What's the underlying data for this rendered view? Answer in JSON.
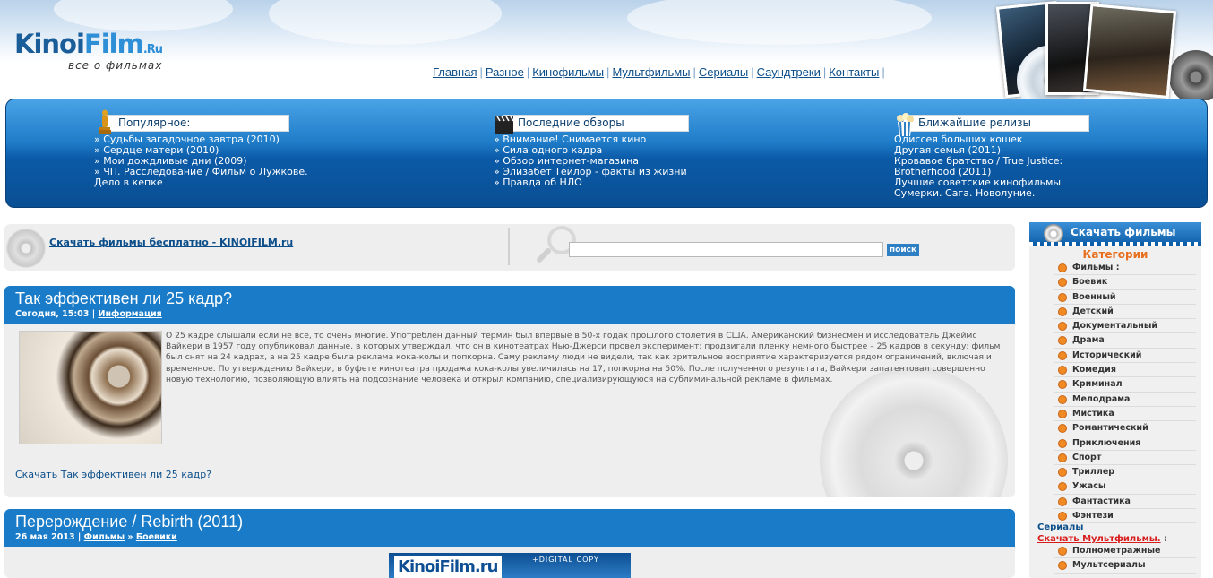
{
  "header": {
    "logo_main": "Kinoi",
    "logo_i": "Film",
    "logo_ru": ".Ru",
    "logo_sub": "все о фильмах",
    "nav": [
      "Главная",
      "Разное",
      "Кинофильмы",
      "Мультфильмы",
      "Сериалы",
      "Саундтреки",
      "Контакты"
    ]
  },
  "band": {
    "popular": {
      "title": "Популярное:",
      "items": [
        "» Судьбы загадочное завтра (2010)",
        "» Сердце матери (2010)",
        "» Мои дождливые дни (2009)",
        "» ЧП. Расследование / Фильм о Лужкове.",
        "Дело в кепке"
      ]
    },
    "reviews": {
      "title": "Последние обзоры",
      "items": [
        "» Внимание! Снимается кино",
        "» Сила одного кадра",
        "» Обзор интернет-магазина",
        "» Элизабет Тейлор - факты из жизни",
        "» Правда об НЛО"
      ]
    },
    "releases": {
      "title": "Ближайшие релизы",
      "items": [
        "Одиссея больших кошек",
        "Другая семья (2011)",
        "Кровавое братство / True Justice:",
        "Brotherhood (2011)",
        "Лучшие советские кинофильмы",
        "Сумерки. Сага. Новолуние."
      ]
    }
  },
  "search": {
    "download_link": "Скачать фильмы бесплатно - KINOIFILM.ru",
    "input_value": "",
    "button": "поиск"
  },
  "articles": [
    {
      "title": "Так эффективен ли 25 кадр?",
      "date": "Сегодня, 15:03",
      "sep": "|",
      "category": "Информация",
      "text": "О 25 кадре слышали если не все, то очень многие. Употреблен данный термин был впервые в 50-х годах прошлого столетия в США. Американский бизнесмен и исследователь Джеймс Вайкери в 1957 году опубликовал данные, в которых утверждал, что он в кинотеатрах Нью-Джерси провел эксперимент: продвигали пленку немного быстрее – 25 кадров в секунду: фильм был снят на 24 кадрах, а на 25 кадре была реклама кока-колы и попкорна. Саму рекламу люди не видели, так как зрительное восприятие характеризуется рядом ограничений, включая и временное. По утверждению Вайкери, в буфете кинотеатра продажа кока-колы увеличилась на 17, попкорна на 50%. После полученного результата, Вайкери запатентовал совершенно новую технологию, позволяющую влиять на подсознание человека и открыл компанию, специализирующуюся на сублиминальной рекламе в фильмах.",
      "more": "Скачать Так эффективен ли 25 кадр?"
    },
    {
      "title": "Перерождение / Rebirth (2011)",
      "date": "26 мая 2013",
      "sep": "|",
      "category": "Фильмы",
      "arrow": "»",
      "subcategory": "Боевики",
      "banner_logo": "KinoiFilm.ru",
      "banner_text": "+DIGITAL COPY"
    }
  ],
  "sidebar": {
    "title": "Скачать фильмы",
    "categories_label": "Категории",
    "items": [
      "Фильмы :",
      "Боевик",
      "Военный",
      "Детский",
      "Документальный",
      "Драма",
      "Исторический",
      "Комедия",
      "Криминал",
      "Мелодрама",
      "Мистика",
      "Романтический",
      "Приключения",
      "Спорт",
      "Триллер",
      "Ужасы",
      "Фантастика",
      "Фэнтези"
    ],
    "serials": "Сериалы",
    "cartoons": "Скачать Мультфильмы.",
    "cartoons_suffix": " :",
    "items2": [
      "Полнометражные",
      "Мультсериалы"
    ]
  },
  "colors": {
    "accent_blue": "#1a7cc8",
    "orange": "#e86f1d",
    "link": "#0b4e8a",
    "red_link": "#d81b1b"
  }
}
